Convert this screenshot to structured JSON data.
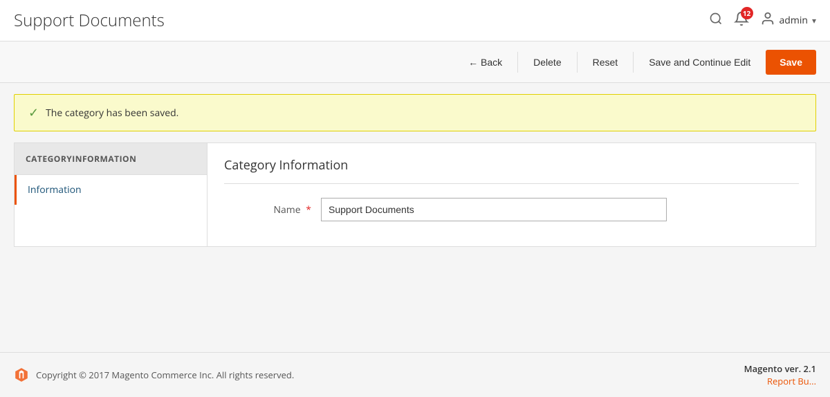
{
  "header": {
    "title": "Support Documents",
    "notification_count": "12",
    "user_name": "admin"
  },
  "toolbar": {
    "back_label": "← Back",
    "delete_label": "Delete",
    "reset_label": "Reset",
    "save_continue_label": "Save and Continue Edit",
    "save_label": "Save"
  },
  "success": {
    "message": "The category has been saved."
  },
  "sidebar": {
    "heading": "CATEGORYINFORMATION",
    "items": [
      {
        "label": "Information"
      }
    ]
  },
  "form": {
    "section_title": "Category Information",
    "name_label": "Name",
    "name_value": "Support Documents"
  },
  "footer": {
    "copyright": "Copyright © 2017 Magento Commerce Inc. All rights reserved.",
    "version_label": "Magento",
    "version_number": "ver. 2.1",
    "report_bug": "Report Bu..."
  }
}
